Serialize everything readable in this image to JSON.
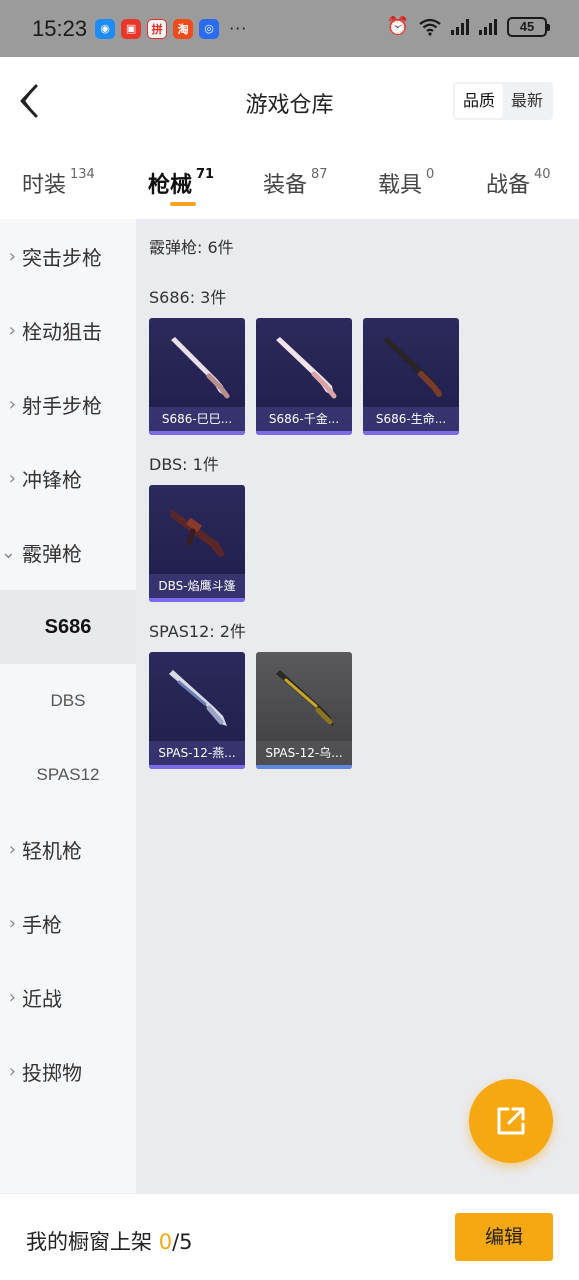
{
  "status_bar": {
    "time": "15:23",
    "battery": "45",
    "notification_icons": [
      "message-icon",
      "chat-icon",
      "pinduoduo-icon",
      "taobao-icon",
      "app-icon"
    ],
    "more": "···"
  },
  "header": {
    "title": "游戏仓库",
    "sort": {
      "quality": "品质",
      "latest": "最新"
    }
  },
  "tabs": [
    {
      "label": "时装",
      "count": "134"
    },
    {
      "label": "枪械",
      "count": "71"
    },
    {
      "label": "装备",
      "count": "87"
    },
    {
      "label": "载具",
      "count": "0"
    },
    {
      "label": "战备",
      "count": "40"
    }
  ],
  "sidebar": [
    {
      "label": "突击步枪"
    },
    {
      "label": "栓动狙击"
    },
    {
      "label": "射手步枪"
    },
    {
      "label": "冲锋枪"
    },
    {
      "label": "霰弹枪"
    },
    {
      "label": "S686"
    },
    {
      "label": "DBS"
    },
    {
      "label": "SPAS12"
    },
    {
      "label": "轻机枪"
    },
    {
      "label": "手枪"
    },
    {
      "label": "近战"
    },
    {
      "label": "投掷物"
    }
  ],
  "content": {
    "category_title": "霰弹枪: 6件",
    "groups": [
      {
        "title": "S686: 3件",
        "items": [
          "S686-巳巳...",
          "S686-千金...",
          "S686-生命..."
        ]
      },
      {
        "title": "DBS: 1件",
        "items": [
          "DBS-焰鹰斗篷"
        ]
      },
      {
        "title": "SPAS12: 2件",
        "items": [
          "SPAS-12-燕...",
          "SPAS-12-乌..."
        ]
      }
    ]
  },
  "bottom": {
    "label": "我的橱窗上架",
    "current": "0",
    "total": "/5",
    "edit": "编辑"
  },
  "colors": {
    "accent": "#f5a812",
    "card_bg": "#2c2a5c",
    "card_bar": "#7b6be8"
  }
}
